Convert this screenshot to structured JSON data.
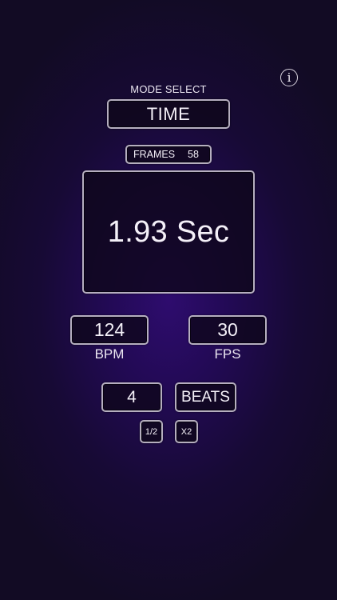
{
  "info": {
    "icon": "info-icon",
    "glyph": "i"
  },
  "mode": {
    "label": "MODE SELECT",
    "value": "TIME"
  },
  "frames": {
    "label": "FRAMES",
    "value": "58"
  },
  "display": {
    "value": "1.93 Sec"
  },
  "bpm": {
    "value": "124",
    "label": "BPM"
  },
  "fps": {
    "value": "30",
    "label": "FPS"
  },
  "beats": {
    "value": "4",
    "button_label": "BEATS"
  },
  "multipliers": {
    "half_label": "1/2",
    "double_label": "X2"
  },
  "colors": {
    "background_center": "#2e0c6e",
    "background_edge": "#120b24",
    "border": "#b5aebf",
    "text": "#f4f0f8"
  }
}
